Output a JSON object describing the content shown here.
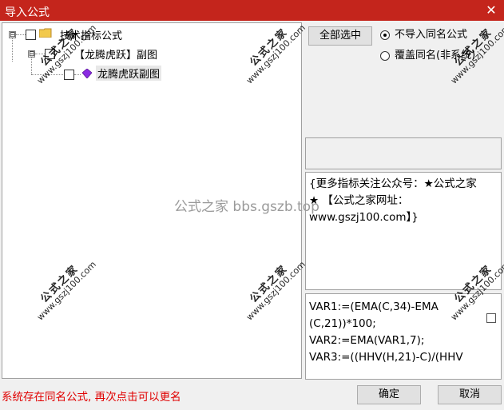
{
  "window": {
    "title": "导入公式",
    "close_icon": "close-icon"
  },
  "tree": {
    "root": {
      "label": "技术指标公式",
      "expander": "⊟",
      "icon": "folder-icon"
    },
    "child": {
      "label": "【龙腾虎跃】副图",
      "expander": "⊟"
    },
    "leaf": {
      "label": "龙腾虎跃副图",
      "icon": "gem-icon"
    }
  },
  "buttons": {
    "select_all": "全部选中",
    "ok": "确定",
    "cancel": "取消"
  },
  "options": {
    "no_import": "不导入同名公式",
    "overwrite": "覆盖同名(非系统)",
    "selected": "no_import"
  },
  "description": "{更多指标关注公众号：★公式之家★ 【公式之家网址：www.gszj100.com】}",
  "code_lines": [
    "VAR1:=(EMA(C,34)-EMA",
    "(C,21))*100;",
    "VAR2:=EMA(VAR1,7);",
    "VAR3:=((HHV(H,21)-C)/(HHV"
  ],
  "status_message": "系统存在同名公式, 再次点击可以更名",
  "watermark": {
    "title": "公式之家",
    "url": "www.gszj100.com",
    "center_text": "公式之家 bbs.gszb.top"
  }
}
